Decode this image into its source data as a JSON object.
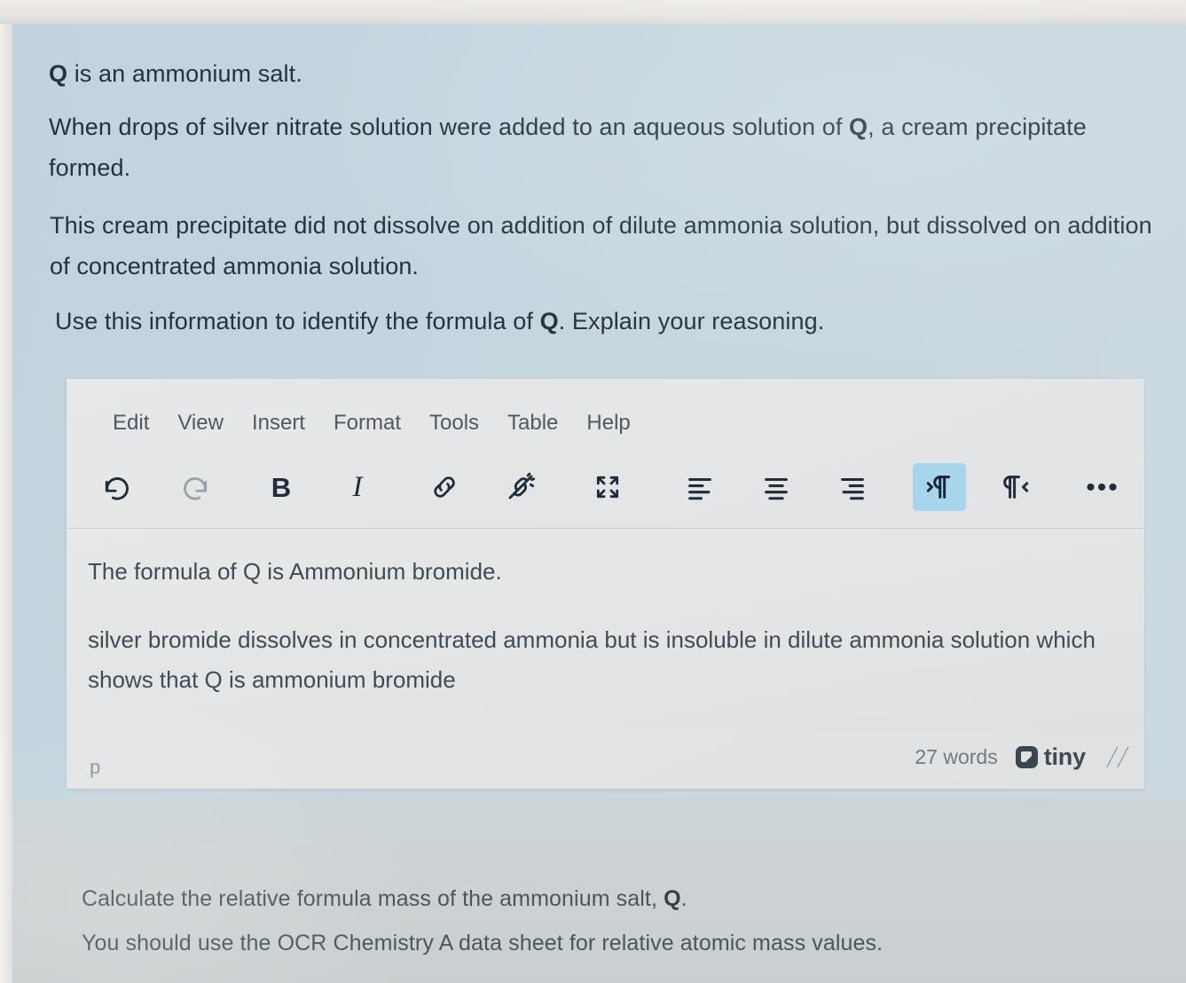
{
  "question": {
    "line1_prefix": "Q",
    "line1_rest": " is an ammonium salt.",
    "para2_a": "When drops of silver nitrate solution were added to an aqueous solution of ",
    "para2_b": "Q",
    "para2_c": ", a cream precipitate formed.",
    "para3": "This cream precipitate did not dissolve on addition of dilute ammonia solution, but dissolved on addition of concentrated ammonia solution.",
    "para4_a": "Use this information to identify the formula of ",
    "para4_b": "Q",
    "para4_c": ".  Explain your reasoning."
  },
  "editor": {
    "menubar": [
      {
        "label": "Edit"
      },
      {
        "label": "View"
      },
      {
        "label": "Insert"
      },
      {
        "label": "Format"
      },
      {
        "label": "Tools"
      },
      {
        "label": "Table"
      },
      {
        "label": "Help"
      }
    ],
    "toolbar": [
      {
        "name": "undo",
        "icon": "undo-icon",
        "state": "enabled"
      },
      {
        "name": "redo",
        "icon": "redo-icon",
        "state": "disabled"
      },
      {
        "name": "bold",
        "icon": "bold-icon",
        "state": "enabled",
        "glyph": "B"
      },
      {
        "name": "italic",
        "icon": "italic-icon",
        "state": "enabled",
        "glyph": "I"
      },
      {
        "name": "link",
        "icon": "link-icon",
        "state": "enabled"
      },
      {
        "name": "unlink",
        "icon": "unlink-icon",
        "state": "enabled"
      },
      {
        "name": "fullscreen",
        "icon": "fullscreen-icon",
        "state": "enabled"
      },
      {
        "name": "align-left",
        "icon": "align-left-icon",
        "state": "enabled"
      },
      {
        "name": "align-center",
        "icon": "align-center-icon",
        "state": "enabled"
      },
      {
        "name": "align-right",
        "icon": "align-right-icon",
        "state": "enabled"
      },
      {
        "name": "ltr",
        "icon": "direction-ltr-icon",
        "state": "active"
      },
      {
        "name": "rtl",
        "icon": "direction-rtl-icon",
        "state": "enabled"
      },
      {
        "name": "more",
        "icon": "more-horizontal-icon",
        "state": "enabled",
        "glyph": "•••"
      }
    ],
    "content": {
      "paragraph_1": "The formula of Q is Ammonium bromide.",
      "paragraph_2": "silver bromide dissolves in concentrated ammonia but is insoluble in dilute ammonia solution which shows that Q is ammonium bromide"
    },
    "statusbar": {
      "element_path": "p",
      "word_count": "27 words",
      "branding": "tiny",
      "resize_handle": "╱╱"
    }
  },
  "bottom": {
    "line1_a": "Calculate the relative formula mass of the ammonium salt, ",
    "line1_b": "Q",
    "line1_c": ".",
    "line2": "You should use the OCR Chemistry A data sheet for relative atomic mass values."
  },
  "colors": {
    "page_background": "#c5d5df",
    "editor_background": "#e4e5e6",
    "active_button": "#a8d4ee",
    "text_dark": "#26323c",
    "text_muted": "#6f7b85"
  }
}
